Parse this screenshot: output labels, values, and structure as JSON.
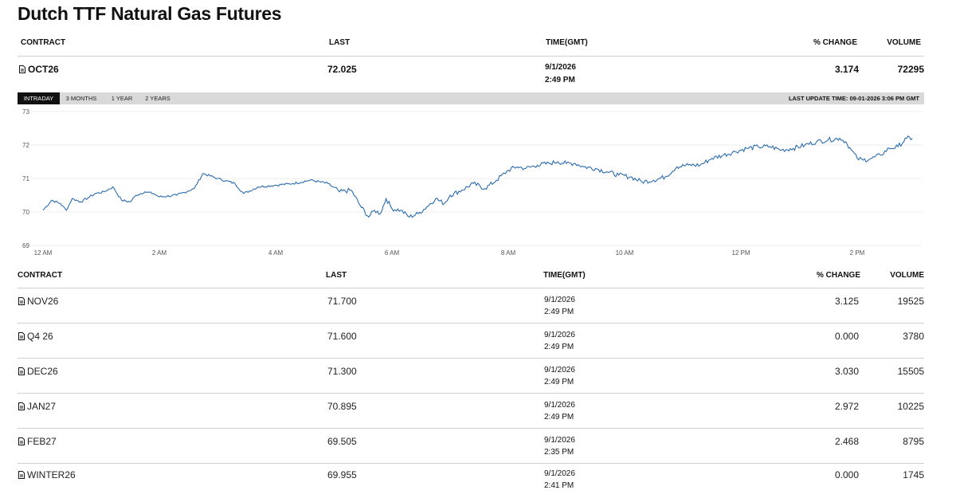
{
  "title": "Dutch TTF Natural Gas Futures",
  "columns": {
    "contract": "CONTRACT",
    "last": "LAST",
    "time": "TIME(GMT)",
    "change": "% CHANGE",
    "volume": "VOLUME"
  },
  "main": {
    "contract": "OCT26",
    "last": "72.025",
    "date": "9/1/2026",
    "time": "2:49 PM",
    "change": "3.174",
    "volume": "72295"
  },
  "ranges": {
    "tabs": [
      "INTRADAY",
      "3 MONTHS",
      "1 YEAR",
      "2 YEARS"
    ],
    "selected": "INTRADAY",
    "last_update": "LAST UPDATE TIME: 09-01-2026 3:06 PM GMT"
  },
  "colors": {
    "line": "#2b6cb0",
    "tab_active": "#111111",
    "bar": "#d9d9d9"
  },
  "icons": {
    "contract": "document-icon"
  },
  "chart_data": {
    "type": "line",
    "title": "",
    "xlabel": "",
    "ylabel": "",
    "ylim": [
      69,
      73
    ],
    "yticks": [
      "73",
      "72",
      "71",
      "70",
      "69"
    ],
    "xticks": [
      "12 AM",
      "2 AM",
      "4 AM",
      "6 AM",
      "8 AM",
      "10 AM",
      "12 PM",
      "2 PM"
    ],
    "x_hours": [
      0.0,
      0.15,
      0.3,
      0.4,
      0.5,
      0.65,
      0.8,
      0.9,
      1.05,
      1.2,
      1.35,
      1.5,
      1.6,
      1.75,
      1.9,
      2.0,
      2.3,
      2.6,
      2.75,
      3.0,
      3.3,
      3.45,
      3.7,
      4.0,
      4.3,
      4.6,
      4.9,
      5.1,
      5.3,
      5.45,
      5.6,
      5.7,
      5.8,
      5.9,
      6.0,
      6.15,
      6.3,
      6.45,
      6.6,
      6.75,
      6.9,
      7.0,
      7.2,
      7.4,
      7.6,
      7.8,
      8.0,
      8.15,
      8.3,
      8.5,
      8.7,
      8.85,
      9.0,
      9.15,
      9.3,
      9.5,
      9.7,
      9.9,
      10.1,
      10.3,
      10.5,
      10.7,
      10.9,
      11.1,
      11.3,
      11.5,
      11.7,
      11.9,
      12.1,
      12.3,
      12.5,
      12.7,
      12.9,
      13.1,
      13.3,
      13.5,
      13.7,
      13.8,
      13.9,
      14.0,
      14.1,
      14.25,
      14.4,
      14.55,
      14.7,
      14.85,
      14.95
    ],
    "values": [
      70.05,
      70.35,
      70.25,
      70.05,
      70.4,
      70.3,
      70.45,
      70.55,
      70.6,
      70.75,
      70.35,
      70.3,
      70.5,
      70.6,
      70.55,
      70.45,
      70.5,
      70.7,
      71.15,
      71.0,
      70.85,
      70.55,
      70.75,
      70.8,
      70.85,
      70.95,
      70.85,
      70.6,
      70.65,
      70.2,
      69.85,
      70.05,
      69.95,
      70.4,
      70.1,
      70.05,
      69.85,
      69.95,
      70.15,
      70.4,
      70.25,
      70.5,
      70.65,
      70.85,
      70.7,
      70.95,
      71.25,
      71.35,
      71.3,
      71.4,
      71.45,
      71.5,
      71.45,
      71.45,
      71.35,
      71.3,
      71.2,
      71.1,
      71.05,
      70.9,
      70.95,
      71.05,
      71.35,
      71.4,
      71.4,
      71.6,
      71.7,
      71.8,
      71.9,
      71.95,
      71.95,
      71.85,
      71.9,
      72.0,
      72.1,
      72.15,
      72.2,
      72.1,
      71.85,
      71.6,
      71.55,
      71.6,
      71.7,
      71.9,
      71.95,
      72.2,
      72.2
    ]
  },
  "contracts": [
    {
      "contract": "NOV26",
      "last": "71.700",
      "date": "9/1/2026",
      "time": "2:49 PM",
      "change": "3.125",
      "volume": "19525"
    },
    {
      "contract": "Q4 26",
      "last": "71.600",
      "date": "9/1/2026",
      "time": "2:49 PM",
      "change": "0.000",
      "volume": "3780"
    },
    {
      "contract": "DEC26",
      "last": "71.300",
      "date": "9/1/2026",
      "time": "2:49 PM",
      "change": "3.030",
      "volume": "15505"
    },
    {
      "contract": "JAN27",
      "last": "70.895",
      "date": "9/1/2026",
      "time": "2:49 PM",
      "change": "2.972",
      "volume": "10225"
    },
    {
      "contract": "FEB27",
      "last": "69.505",
      "date": "9/1/2026",
      "time": "2:35 PM",
      "change": "2.468",
      "volume": "8795"
    },
    {
      "contract": "WINTER26",
      "last": "69.955",
      "date": "9/1/2026",
      "time": "2:41 PM",
      "change": "0.000",
      "volume": "1745"
    }
  ]
}
